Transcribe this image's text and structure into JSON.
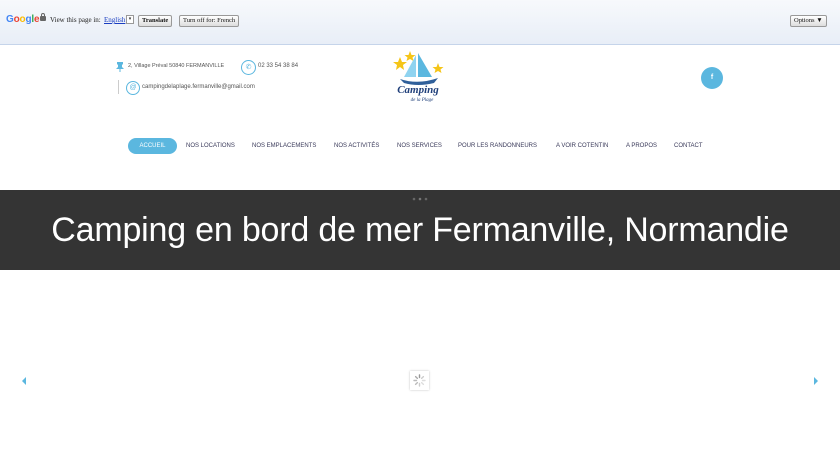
{
  "translate_bar": {
    "logo": "Google",
    "prompt": "View this page in:",
    "language": "English",
    "caret": "▾",
    "translate_button": "Translate",
    "turn_off_button": "Turn off for: French",
    "options_button": "Options ▼"
  },
  "header": {
    "address": "2, Village Préval 50840 FERMANVILLE",
    "phone": "02 33 54 38 84",
    "email": "campingdelaplage.fermanville@gmail.com",
    "logo_text": "Camping",
    "logo_subtext": "de la Plage",
    "facebook_label": "f"
  },
  "nav": {
    "items": [
      {
        "label": "ACCUEIL",
        "active": true
      },
      {
        "label": "NOS LOCATIONS"
      },
      {
        "label": "NOS EMPLACEMENTS"
      },
      {
        "label": "NOS ACTIVITÉS"
      },
      {
        "label": "NOS SERVICES"
      },
      {
        "label": "POUR LES RANDONNEURS"
      },
      {
        "label": "A VOIR COTENTIN"
      },
      {
        "label": "A PROPOS"
      },
      {
        "label": "CONTACT"
      }
    ]
  },
  "banner": {
    "title": "Camping en bord de mer Fermanville, Normandie"
  },
  "colors": {
    "accent": "#5bb7df",
    "banner_bg": "#343434"
  }
}
